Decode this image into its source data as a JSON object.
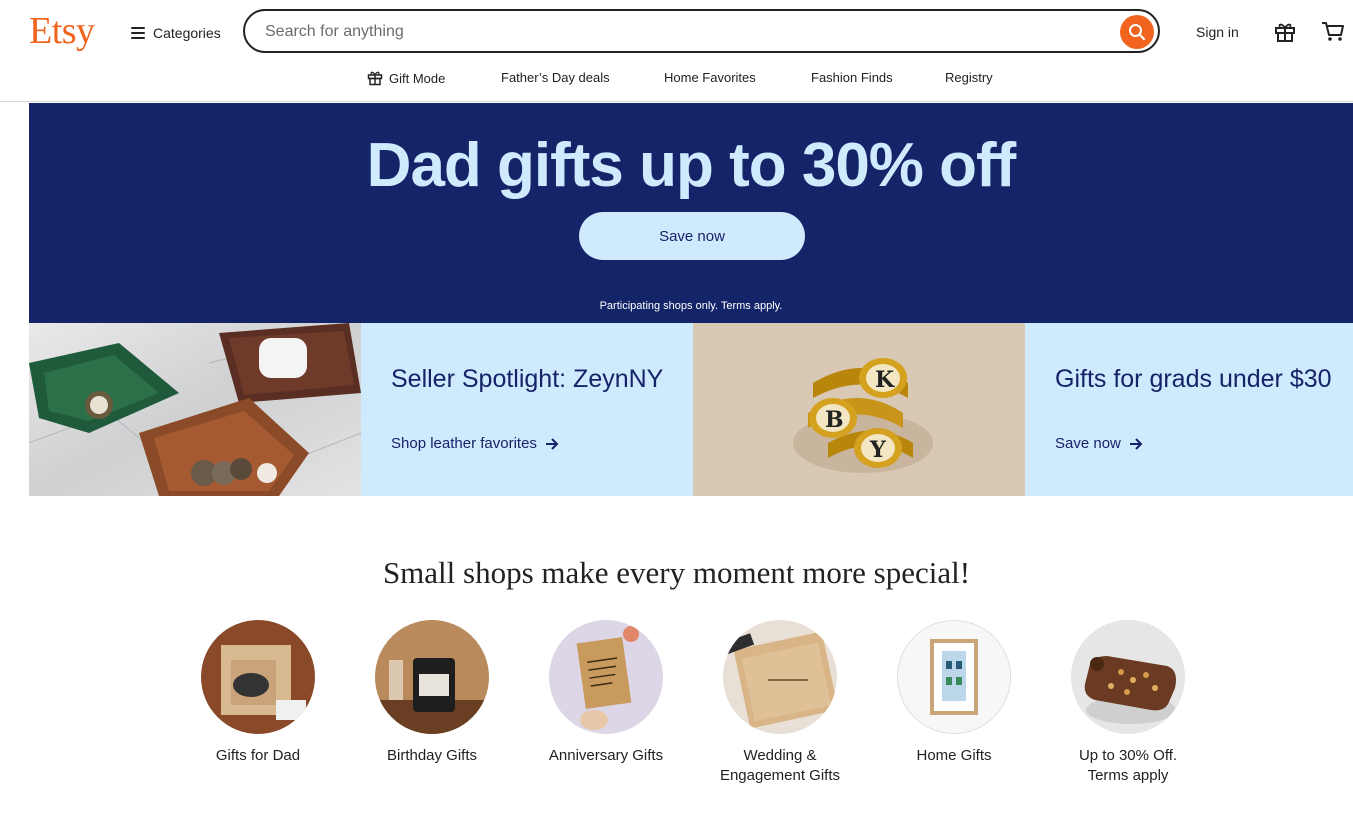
{
  "header": {
    "logo": "Etsy",
    "categories_label": "Categories",
    "search_placeholder": "Search for anything",
    "signin_label": "Sign in"
  },
  "subnav": [
    {
      "label": "Gift Mode",
      "icon": "gift-icon"
    },
    {
      "label": "Father’s Day deals"
    },
    {
      "label": "Home Favorites"
    },
    {
      "label": "Fashion Finds"
    },
    {
      "label": "Registry"
    }
  ],
  "hero": {
    "title": "Dad gifts up to 30% off",
    "button": "Save now",
    "terms": "Participating shops only. Terms apply."
  },
  "tiles": [
    {
      "title": "Seller Spotlight: ZeynNY",
      "link": "Shop leather favorites"
    },
    {
      "title": "Gifts for grads under $30",
      "link": "Save now"
    }
  ],
  "section": {
    "title": "Small shops make every moment more special!",
    "items": [
      {
        "label": "Gifts for Dad"
      },
      {
        "label": "Birthday Gifts"
      },
      {
        "label": "Anniversary Gifts"
      },
      {
        "label": "Wedding & Engagement Gifts"
      },
      {
        "label": "Home Gifts"
      },
      {
        "label": "Up to 30% Off. Terms apply"
      }
    ]
  },
  "colors": {
    "brand": "#f1641e",
    "hero_bg": "#142468",
    "hero_text": "#cfe9fd",
    "tile_bg": "#cfe9fd"
  }
}
